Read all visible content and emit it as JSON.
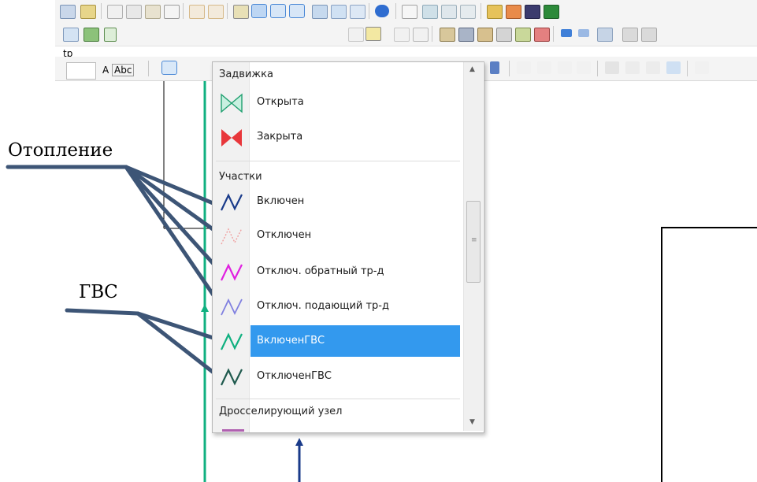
{
  "toolbar": {
    "row1_icons": [
      "print-preview-icon",
      "open-icon",
      "cut-icon",
      "copy-icon",
      "paste-icon",
      "delete-icon",
      "undo-icon",
      "redo-icon",
      "properties-icon",
      "layout-icon",
      "list-icon",
      "grid-icon",
      "table-icon",
      "map-icon",
      "window-icon",
      "help-icon",
      "document-icon",
      "layers-icon",
      "layers-edit-icon",
      "layers-add-icon",
      "tool-icon",
      "paint-icon",
      "edit-icon",
      "export-icon"
    ],
    "row2_label": "tp",
    "text_tool_label": "A",
    "abc_label": "Abc"
  },
  "dropdown": {
    "group_valve": "Задвижка",
    "valve_open": "Открыта",
    "valve_closed": "Закрыта",
    "group_sections": "Участки",
    "items": [
      {
        "label": "Включен",
        "color": "#1a3b8a"
      },
      {
        "label": "Отключен",
        "color": "#f0a0a0"
      },
      {
        "label": "Отключ. обратный тр-д",
        "color": "#e020e0"
      },
      {
        "label": "Отключ. подающий тр-д",
        "color": "#8080e0"
      },
      {
        "label": "ВключенГВС",
        "color": "#10b080"
      },
      {
        "label": "ОтключенГВС",
        "color": "#1f5a4e"
      }
    ],
    "group_throttle": "Дросселирующий узел",
    "selected_color": "#3399ee"
  },
  "annotations": {
    "heating": "Отопление",
    "hot_water": "ГВС"
  }
}
